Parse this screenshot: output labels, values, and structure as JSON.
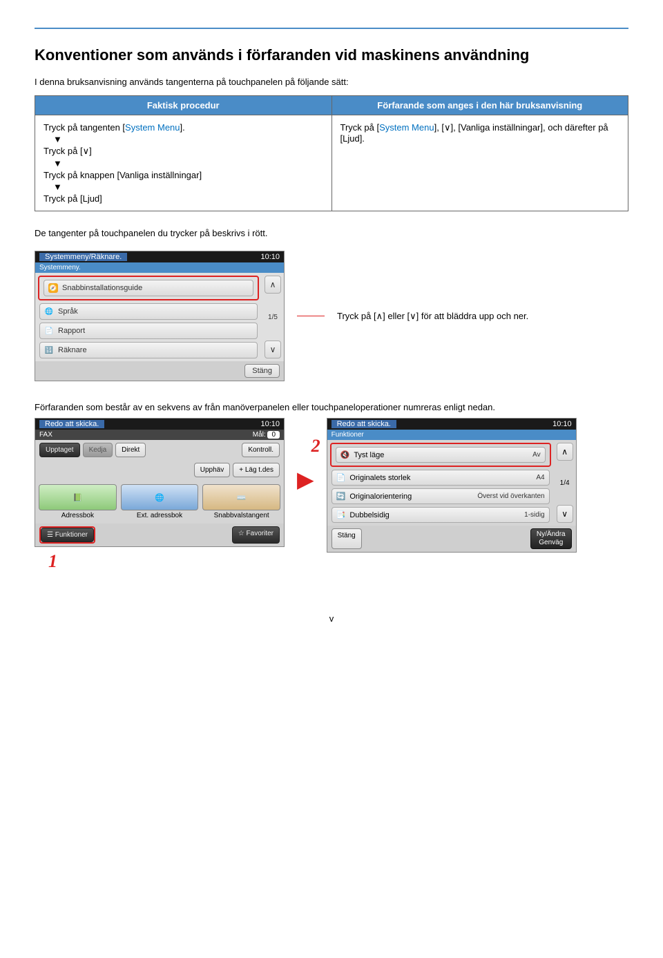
{
  "heading": "Konventioner som används i förfaranden vid maskinens användning",
  "intro": "I denna bruksanvisning används tangenterna på touchpanelen på följande sätt:",
  "table": {
    "col1": "Faktisk procedur",
    "col2": "Förfarande som anges i den här bruksanvisning",
    "left_step1_pre": "Tryck på tangenten [",
    "left_step1_sysmenu": "System Menu",
    "left_step1_post": "].",
    "left_step2": "Tryck på [    ]",
    "left_step3": "Tryck på knappen [Vanliga inställningar]",
    "left_step4": "Tryck på [Ljud]",
    "right_pre": "Tryck på [",
    "right_sys": "System Menu",
    "right_mid": "], [    ], [Vanliga inställningar], och därefter på [Ljud].",
    "arrow": "▼"
  },
  "subtext": "De tangenter på touchpanelen du trycker på beskrivs i rött.",
  "screen1": {
    "title": "Systemmeny/Räknare.",
    "time": "10:10",
    "subhead": "Systemmeny.",
    "items": [
      "Snabbinstallationsguide",
      "Språk",
      "Rapport",
      "Räknare"
    ],
    "page": "1/5",
    "close": "Stäng",
    "up": "∧",
    "down": "∨"
  },
  "callout": "Tryck på [    ] eller [    ] för att bläddra upp och ner.",
  "callout_up": "∧",
  "callout_down": "∨",
  "subtext2": "Förfaranden som består av en sekvens av från manöverpanelen eller touchpaneloperationer numreras enligt nedan.",
  "fax": {
    "title": "Redo att skicka.",
    "time": "10:10",
    "sub": "FAX",
    "dest_label": "Mål:",
    "dest_val": "0",
    "btn_busy": "Upptaget",
    "btn_chain": "Kedja",
    "btn_direct": "Direkt",
    "btn_check": "Kontroll.",
    "btn_cancel": "Upphäv",
    "btn_add": "Läg t.des",
    "plus": "+",
    "icon_addr": "Adressbok",
    "icon_ext": "Ext. adressbok",
    "icon_speed": "Snabbvalstangent",
    "bottom_func": "Funktioner",
    "bottom_fav": "Favoriter"
  },
  "func": {
    "title": "Redo att skicka.",
    "time": "10:10",
    "sub": "Funktioner",
    "items": [
      {
        "l": "Tyst läge",
        "r": "Av"
      },
      {
        "l": "Originalets storlek",
        "r": "A4"
      },
      {
        "l": "Originalorientering",
        "r": "Överst vid överkanten"
      },
      {
        "l": "Dubbelsidig",
        "r": "1-sidig"
      }
    ],
    "page": "1/4",
    "close": "Stäng",
    "shortcut1": "Ny/Ändra",
    "shortcut2": "Genväg",
    "up": "∧",
    "down": "∨"
  },
  "step1": "1",
  "step2": "2",
  "tri": "▶",
  "pagenum": "v"
}
